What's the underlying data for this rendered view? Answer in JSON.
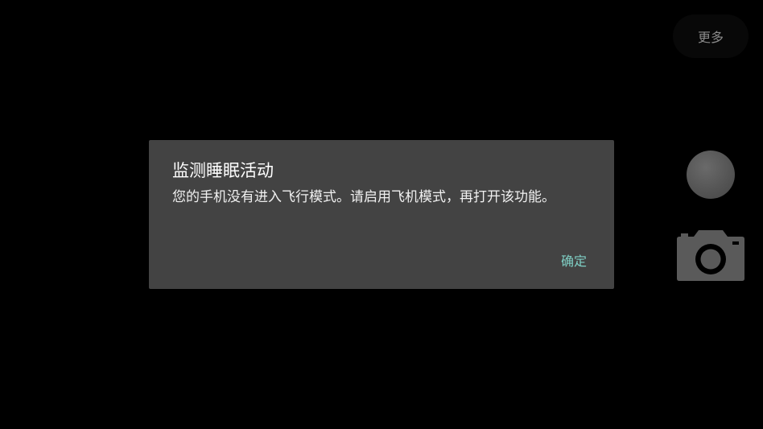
{
  "top_bar": {
    "more_label": "更多"
  },
  "controls": {
    "shutter_icon": "circle-shutter",
    "camera_icon": "camera-icon"
  },
  "dialog": {
    "title": "监测睡眠活动",
    "message": "您的手机没有进入飞行模式。请启用飞机模式，再打开该功能。",
    "confirm_label": "确定"
  },
  "colors": {
    "background": "#000000",
    "dialog_bg": "#434343",
    "accent": "#7fcfc4",
    "control_gray": "#5a5a5a"
  }
}
